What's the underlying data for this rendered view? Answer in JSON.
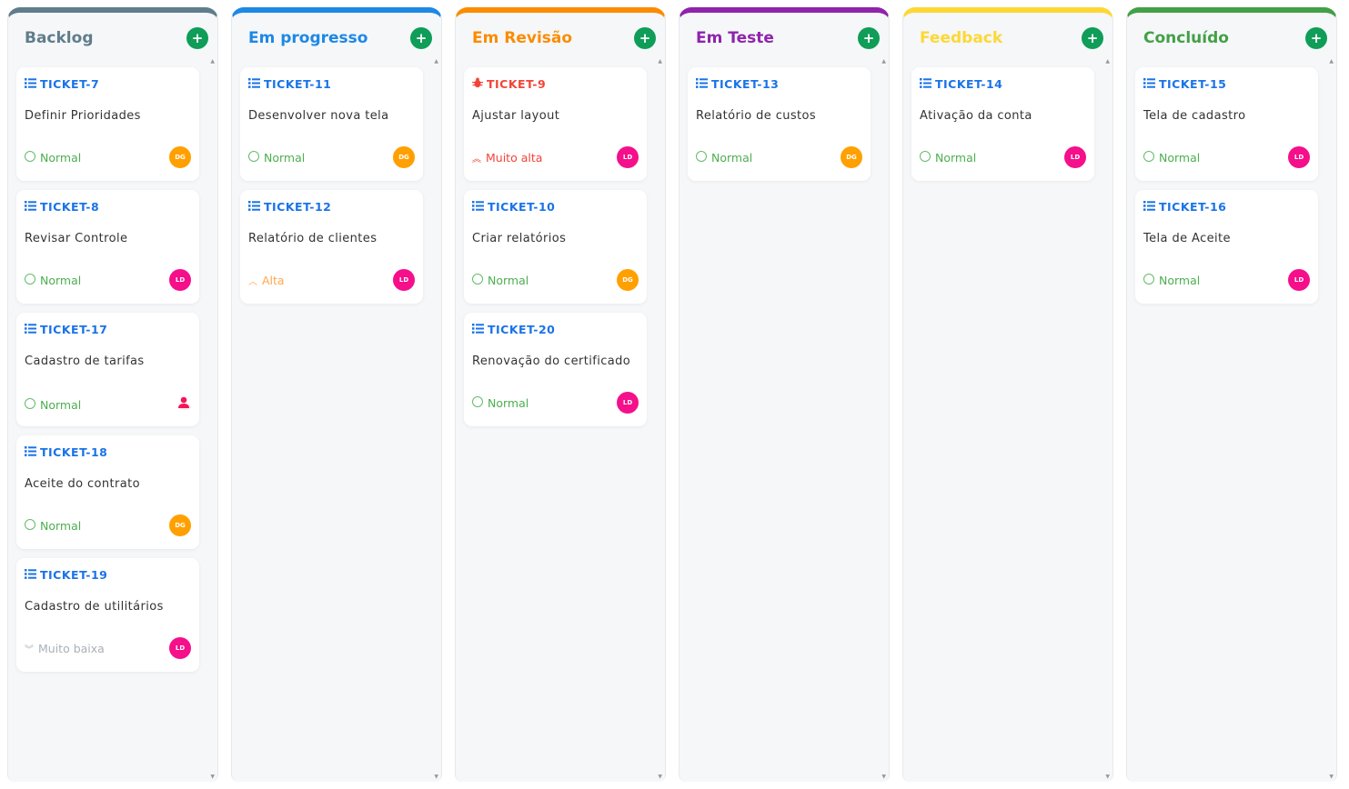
{
  "priorities": {
    "Normal": {
      "color": "#4caf50",
      "icon": "circle-icon"
    },
    "Muito alta": {
      "color": "#f44336",
      "icon": "double-chevron-up-icon"
    },
    "Alta": {
      "color": "#ffa74d",
      "icon": "chevron-up-icon"
    },
    "Muito baixa": {
      "color": "#aab0b6",
      "icon": "double-chevron-down-icon"
    }
  },
  "avatars": {
    "DG": "#ffa000",
    "LD": "#f50f8a",
    "user": "#f5145a"
  },
  "add_icon": "plus-icon",
  "columns": [
    {
      "title": "Backlog",
      "color": "#607d8b",
      "cards": [
        {
          "id": "TICKET-7",
          "type": "task",
          "title": "Definir Prioridades",
          "priority": "Normal",
          "assignee": "DG"
        },
        {
          "id": "TICKET-8",
          "type": "task",
          "title": "Revisar Controle",
          "priority": "Normal",
          "assignee": "LD"
        },
        {
          "id": "TICKET-17",
          "type": "task",
          "title": "Cadastro de tarifas",
          "priority": "Normal",
          "assignee": ""
        },
        {
          "id": "TICKET-18",
          "type": "task",
          "title": "Aceite do contrato",
          "priority": "Normal",
          "assignee": "DG"
        },
        {
          "id": "TICKET-19",
          "type": "task",
          "title": "Cadastro de utilitários",
          "priority": "Muito baixa",
          "assignee": "LD"
        }
      ]
    },
    {
      "title": "Em progresso",
      "color": "#1e88e5",
      "cards": [
        {
          "id": "TICKET-11",
          "type": "task",
          "title": "Desenvolver nova tela",
          "priority": "Normal",
          "assignee": "DG"
        },
        {
          "id": "TICKET-12",
          "type": "task",
          "title": "Relatório de clientes",
          "priority": "Alta",
          "assignee": "LD"
        }
      ]
    },
    {
      "title": "Em Revisão",
      "color": "#fb8c00",
      "cards": [
        {
          "id": "TICKET-9",
          "type": "bug",
          "title": "Ajustar layout",
          "priority": "Muito alta",
          "assignee": "LD"
        },
        {
          "id": "TICKET-10",
          "type": "task",
          "title": "Criar relatórios",
          "priority": "Normal",
          "assignee": "DG"
        },
        {
          "id": "TICKET-20",
          "type": "task",
          "title": "Renovação do certificado",
          "priority": "Normal",
          "assignee": "LD"
        }
      ]
    },
    {
      "title": "Em Teste",
      "color": "#8e24aa",
      "cards": [
        {
          "id": "TICKET-13",
          "type": "task",
          "title": "Relatório de custos",
          "priority": "Normal",
          "assignee": "DG"
        }
      ]
    },
    {
      "title": "Feedback",
      "color": "#fdd835",
      "cards": [
        {
          "id": "TICKET-14",
          "type": "task",
          "title": "Ativação da conta",
          "priority": "Normal",
          "assignee": "LD"
        }
      ]
    },
    {
      "title": "Concluído",
      "color": "#43a047",
      "cards": [
        {
          "id": "TICKET-15",
          "type": "task",
          "title": "Tela de cadastro",
          "priority": "Normal",
          "assignee": "LD"
        },
        {
          "id": "TICKET-16",
          "type": "task",
          "title": "Tela de Aceite",
          "priority": "Normal",
          "assignee": "LD"
        }
      ]
    }
  ]
}
